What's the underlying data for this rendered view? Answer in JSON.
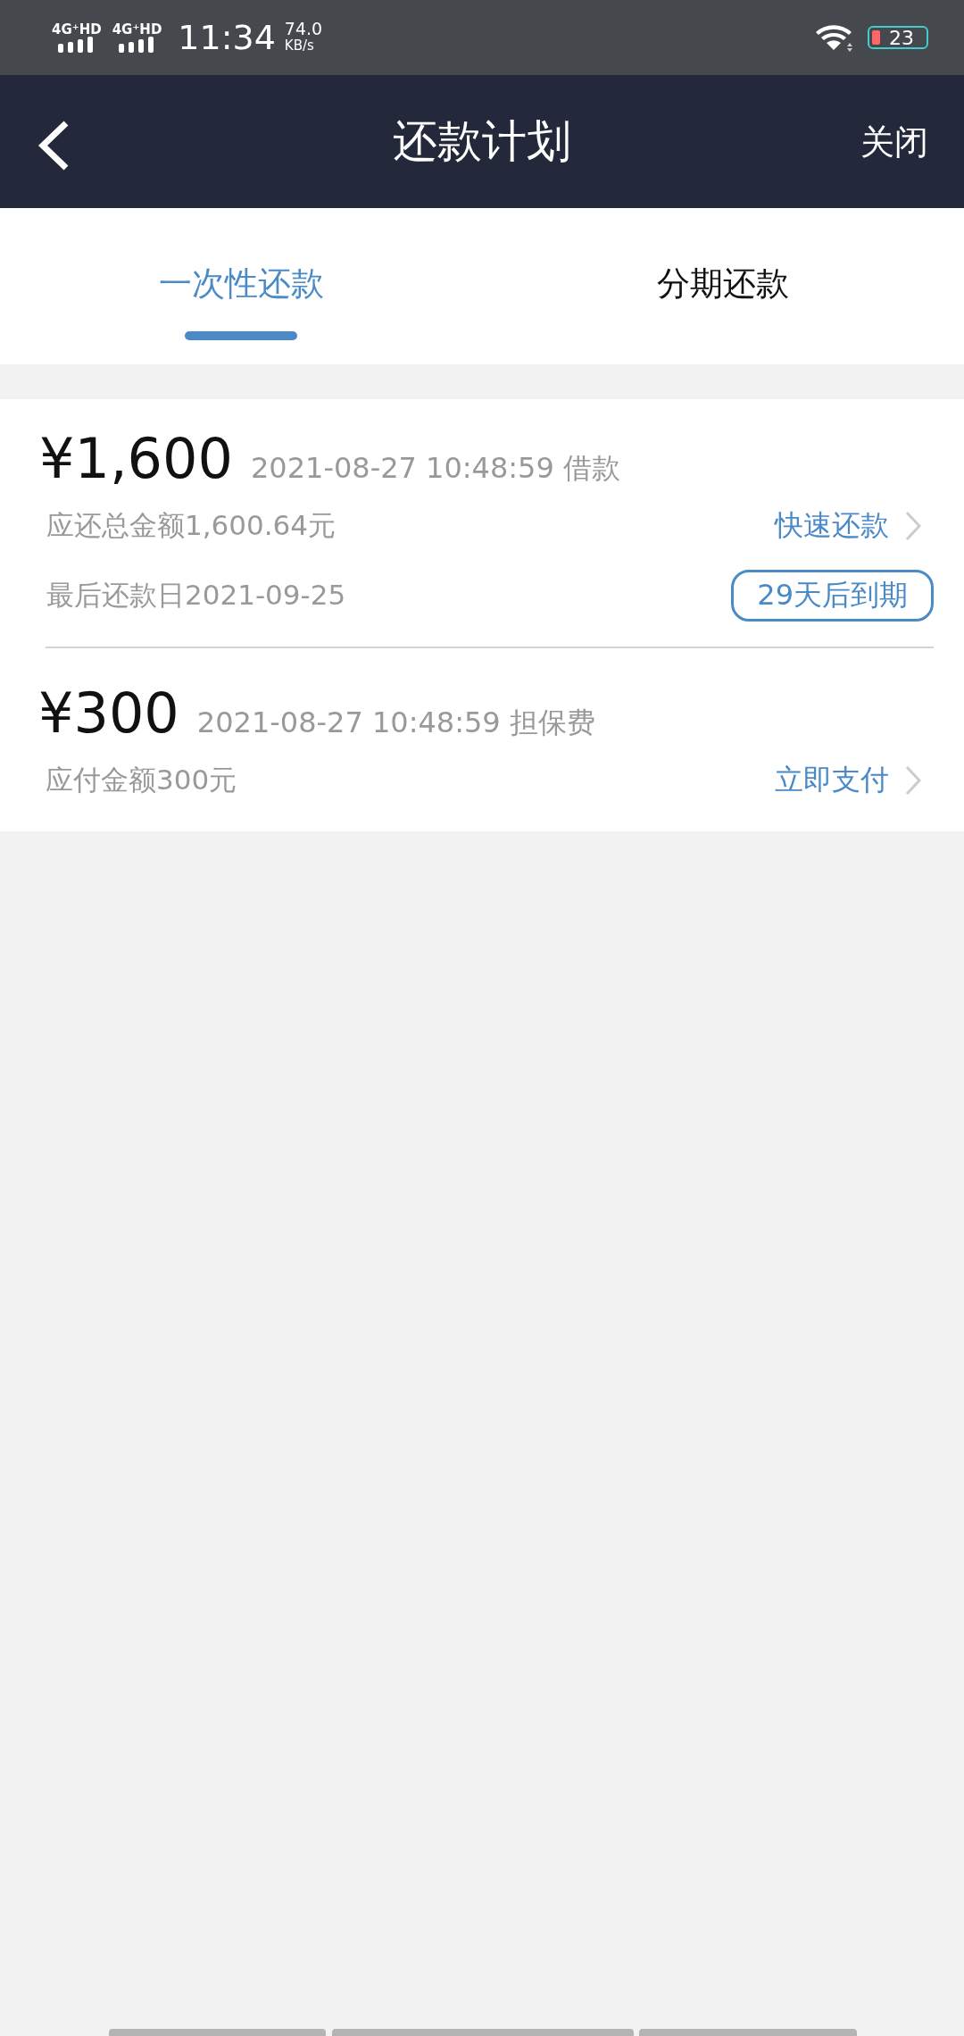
{
  "status_bar": {
    "networks": [
      "4G⁺HD",
      "4G⁺HD"
    ],
    "time": "11:34",
    "speed_value": "74.0",
    "speed_unit": "KB/s",
    "battery": "23"
  },
  "header": {
    "title": "还款计划",
    "close": "关闭"
  },
  "tabs": [
    {
      "label": "一次性还款",
      "selected": true
    },
    {
      "label": "分期还款",
      "selected": false
    }
  ],
  "bills": [
    {
      "amount": "¥1,600",
      "datetime": "2021-08-27 10:48:59",
      "type": "借款",
      "lines": [
        {
          "text": "应还总金额1,600.64元",
          "action": {
            "kind": "link",
            "text": "快速还款"
          }
        },
        {
          "text": "最后还款日2021-09-25",
          "action": {
            "kind": "badge",
            "text": "29天后到期"
          }
        }
      ]
    },
    {
      "amount": "¥300",
      "datetime": "2021-08-27 10:48:59",
      "type": "担保费",
      "lines": [
        {
          "text": "应付金额300元",
          "action": {
            "kind": "link",
            "text": "立即支付"
          }
        }
      ]
    }
  ]
}
